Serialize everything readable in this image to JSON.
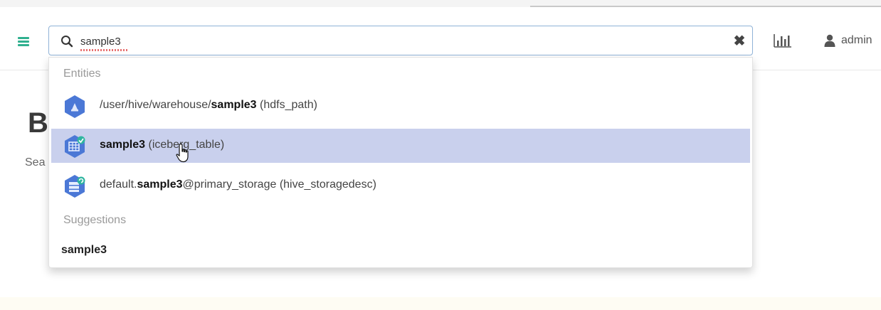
{
  "search": {
    "value": "sample3",
    "placeholder": "",
    "clear_symbol": "✖"
  },
  "header": {
    "user_label": "admin",
    "icons": [
      "hamburger-menu-icon",
      "bar-chart-icon",
      "user-icon"
    ]
  },
  "background": {
    "heading_fragment": "B",
    "text_fragment": "Sea"
  },
  "dropdown": {
    "entities_label": "Entities",
    "suggestions_label": "Suggestions",
    "entities": [
      {
        "prefix": "/user/hive/warehouse/",
        "match": "sample3",
        "suffix": "",
        "type": "(hdfs_path)",
        "icon": "hdfs-path-icon",
        "active": false
      },
      {
        "prefix": "",
        "match": "sample3",
        "suffix": "",
        "type": "(iceberg_table)",
        "icon": "iceberg-table-icon",
        "active": true
      },
      {
        "prefix": "default.",
        "match": "sample3",
        "suffix": "@primary_storage",
        "type": "(hive_storagedesc)",
        "icon": "hive-storagedesc-icon",
        "active": false
      }
    ],
    "suggestions": [
      "sample3"
    ]
  },
  "colors": {
    "accent_green": "#30b08f",
    "highlight_row": "#c9d0ed",
    "search_border": "#8fb2d7",
    "entity_icon_blue": "#4b78d6",
    "entity_icon_teal": "#2fb5a0"
  }
}
